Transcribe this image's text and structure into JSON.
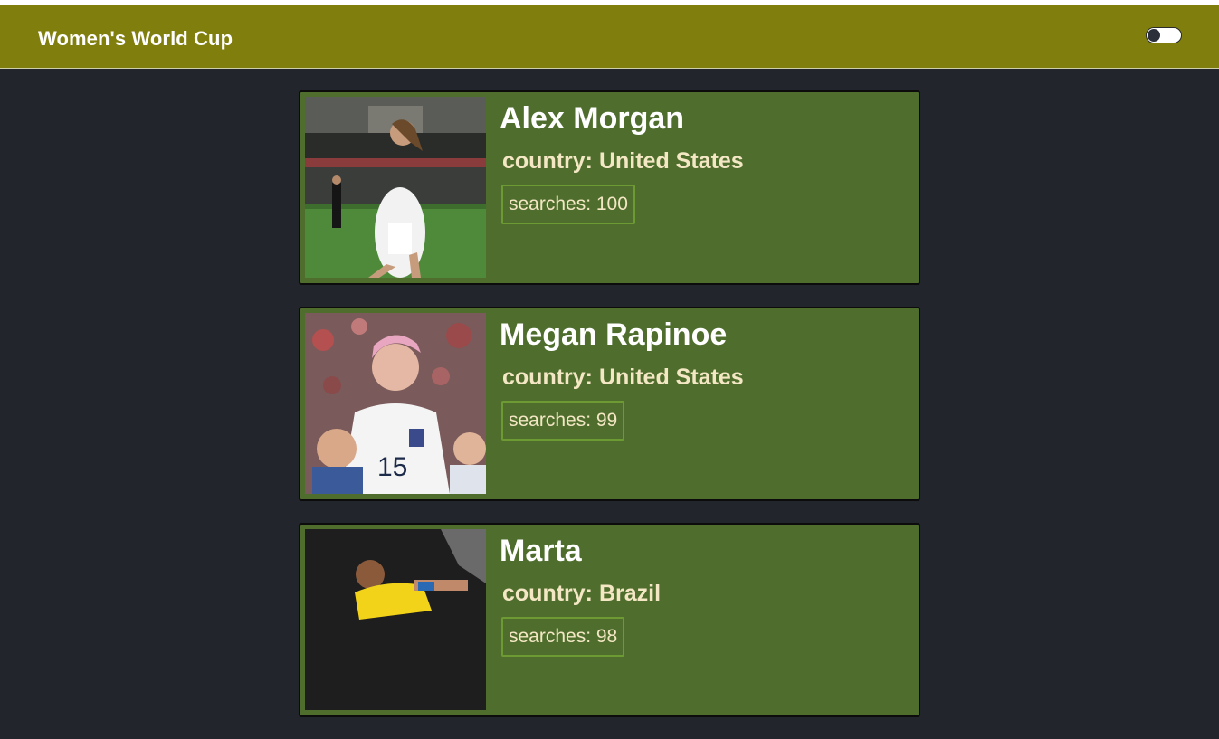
{
  "header": {
    "title": "Women's World Cup"
  },
  "players": [
    {
      "name": "Alex Morgan",
      "country": "country: United States",
      "searches": "searches: 100"
    },
    {
      "name": "Megan Rapinoe",
      "country": "country: United States",
      "searches": "searches: 99"
    },
    {
      "name": "Marta",
      "country": "country: Brazil",
      "searches": "searches: 98"
    }
  ],
  "colors": {
    "header_bg": "#807e0c",
    "page_bg": "#23252c",
    "card_bg": "#4f6e2e",
    "accent_text": "#f4e7c4"
  }
}
